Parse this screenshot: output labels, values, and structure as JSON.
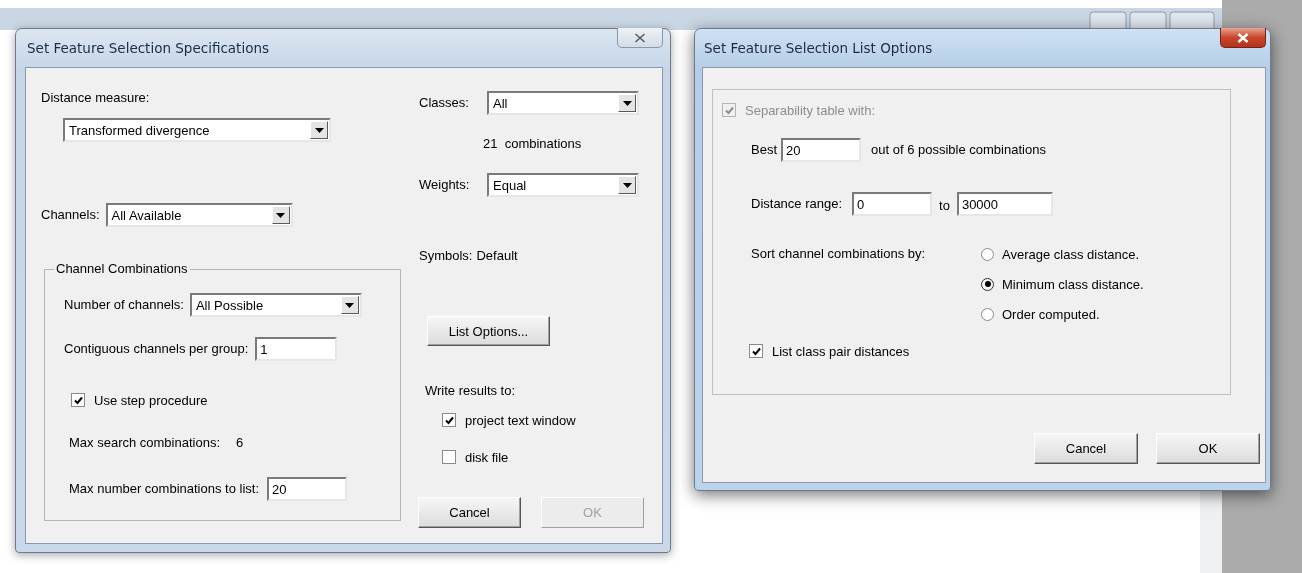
{
  "specifications_dialog": {
    "title": "Set Feature Selection Specifications",
    "active": false,
    "distance_measure": {
      "label": "Distance measure:",
      "value": "Transformed divergence"
    },
    "channels": {
      "label": "Channels:",
      "value": "All Available"
    },
    "channel_combinations": {
      "title": "Channel Combinations",
      "number_of_channels": {
        "label": "Number of channels:",
        "value": "All Possible"
      },
      "contiguous_channels": {
        "label": "Contiguous channels per group:",
        "value": "1"
      },
      "use_step_procedure": {
        "label": "Use step procedure",
        "checked": true
      },
      "max_search_combinations": {
        "label": "Max search combinations:",
        "value": "6"
      },
      "max_list_combinations": {
        "label": "Max number combinations to list:",
        "value": "20"
      }
    },
    "classes": {
      "label": "Classes:",
      "value": "All"
    },
    "combinations_count": "21  combinations",
    "weights": {
      "label": "Weights:",
      "value": "Equal"
    },
    "symbols": {
      "label": "Symbols:",
      "value": "Default"
    },
    "list_options_button": {
      "label": "List Options...",
      "disabled": false
    },
    "write_results": {
      "label": "Write results to:",
      "options": [
        {
          "label": "project text window",
          "checked": true
        },
        {
          "label": "disk file",
          "checked": false
        }
      ]
    },
    "buttons": [
      {
        "label": "Cancel",
        "disabled": false
      },
      {
        "label": "OK",
        "disabled": true
      }
    ]
  },
  "list_options_dialog": {
    "title": "Set Feature Selection List Options",
    "active": true,
    "separability_table": {
      "label": "Separability table with:",
      "checked": true,
      "disabled": true
    },
    "best": {
      "label": "Best",
      "value": "20",
      "suffix": "out of 6 possible combinations"
    },
    "distance_range": {
      "label": "Distance range:",
      "from": "0",
      "separator": "to",
      "to": "30000"
    },
    "sort_by": {
      "label": "Sort channel combinations by:",
      "options": [
        {
          "label": "Average class distance.",
          "selected": false
        },
        {
          "label": "Minimum class distance.",
          "selected": true
        },
        {
          "label": "Order computed.",
          "selected": false
        }
      ]
    },
    "list_class_pair_distances": {
      "label": "List class pair distances",
      "checked": true,
      "disabled": false
    },
    "buttons": [
      {
        "label": "Cancel",
        "disabled": false
      },
      {
        "label": "OK",
        "disabled": false
      }
    ]
  }
}
